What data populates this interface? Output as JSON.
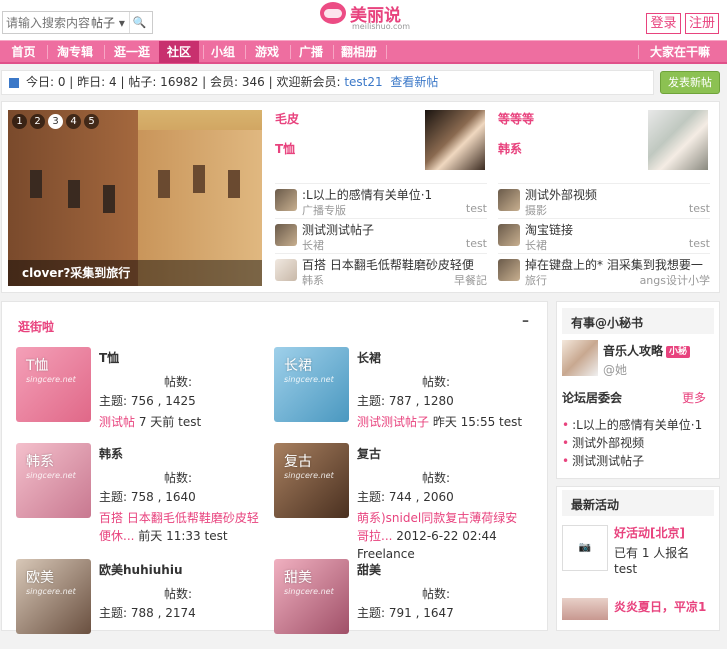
{
  "header": {
    "search_placeholder": "请输入搜索内容",
    "search_scope": "帖子",
    "logo_cn": "美丽说",
    "logo_en": "meilishuo.com",
    "login": "登录",
    "register": "注册"
  },
  "nav": {
    "items": [
      "首页",
      "淘专辑",
      "逛一逛",
      "社区",
      "小组",
      "游戏",
      "广播",
      "翻相册"
    ],
    "right": "大家在干嘛",
    "active_index": 3
  },
  "stats": {
    "text": "今日: 0 | 昨日: 4 | 帖子: 16982 | 会员: 346 | 欢迎新会员:",
    "new_member": "test21",
    "view_new": "查看新帖",
    "post_button": "发表新帖"
  },
  "slider": {
    "pages": [
      "1",
      "2",
      "3",
      "4",
      "5"
    ],
    "active_page": 3,
    "caption": "clover?采集到旅行"
  },
  "featured": {
    "col1": {
      "title": "毛皮",
      "subtitle": "T恤"
    },
    "col2": {
      "title": "等等等",
      "subtitle": "韩系"
    }
  },
  "recent_posts": [
    {
      "title": ":L以上的感情有关单位·1",
      "cat": "广播专版",
      "user": "test"
    },
    {
      "title": "测试外部视频",
      "cat": "摄影",
      "user": "test"
    },
    {
      "title": "测试测试帖子",
      "cat": "长裙",
      "user": "test"
    },
    {
      "title": "淘宝链接",
      "cat": "长裙",
      "user": "test"
    },
    {
      "title": "百搭 日本翻毛低帮鞋磨砂皮轻便",
      "cat": "韩系",
      "user": "早餐記"
    },
    {
      "title": "掉在键盘上的* 泪采集到我想要一",
      "cat": "旅行",
      "user": "angs设计小学"
    }
  ],
  "forums_section": {
    "title": "逛街啦",
    "collapse": "–"
  },
  "forums": [
    {
      "img_label": "T恤",
      "img_sub": "singcere.net",
      "name": "T恤",
      "posts_label": "帖数:",
      "nums": "主题: 756 , 1425",
      "last_link": "测试帖",
      "last_meta": "7 天前 test",
      "color": "#e88aa8"
    },
    {
      "img_label": "长裙",
      "img_sub": "singcere.net",
      "name": "长裙",
      "posts_label": "帖数:",
      "nums": "主题: 787 , 1280",
      "last_link": "测试测试帖子",
      "last_meta": "昨天 15:55 test",
      "color": "#6fb3d6"
    },
    {
      "img_label": "韩系",
      "img_sub": "singcere.net",
      "name": "韩系",
      "posts_label": "帖数:",
      "nums": "主题: 758 , 1640",
      "last_link": "百搭 日本翻毛低帮鞋磨砂皮轻便休...",
      "last_meta": "前天 11:33 test",
      "color": "#e8a0b4"
    },
    {
      "img_label": "复古",
      "img_sub": "singcere.net",
      "name": "复古",
      "posts_label": "帖数:",
      "nums": "主题: 744 , 2060",
      "last_link": "萌系)snidel同款复古薄荷绿安哥拉...",
      "last_meta": "2012-6-22 02:44 Freelance",
      "color": "#8a6a4a"
    },
    {
      "img_label": "欧美",
      "img_sub": "singcere.net",
      "name": "欧美huhiuhiu",
      "posts_label": "帖数:",
      "nums": "主题: 788 , 2174",
      "last_link": "",
      "last_meta": "",
      "color": "#a89080"
    },
    {
      "img_label": "甜美",
      "img_sub": "singcere.net",
      "name": "甜美",
      "posts_label": "帖数:",
      "nums": "主题: 791 , 1647",
      "last_link": "",
      "last_meta": "",
      "color": "#d88098"
    }
  ],
  "sidebar": {
    "secretary_title": "有事@小秘书",
    "secretary_name": "音乐人攻略",
    "secretary_badge": "小秘",
    "secretary_handle": "@她",
    "committee_title": "论坛居委会",
    "more": "更多",
    "committee_items": [
      ":L以上的感情有关单位·1",
      "测试外部视频",
      "测试测试帖子"
    ],
    "activity_title": "最新活动",
    "activity_name": "好活动[北京]",
    "activity_count": "已有 1 人报名",
    "activity_user": "test",
    "activity2": "炎炎夏日，平凉1"
  }
}
